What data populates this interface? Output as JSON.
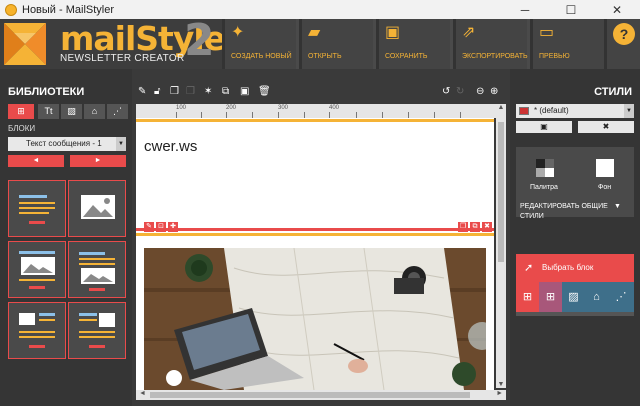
{
  "window": {
    "title": "Новый - MailStyler",
    "minimize": "─",
    "maximize": "☐",
    "close": "✕"
  },
  "logo": {
    "brand": "mailStyler",
    "version": "2",
    "subtitle": "NEWSLETTER CREATOR"
  },
  "toolbar": [
    {
      "label": "СОЗДАТЬ НОВЫЙ",
      "icon": "new-doc-icon",
      "glyph": "✦"
    },
    {
      "label": "ОТКРЫТЬ",
      "icon": "folder-icon",
      "glyph": "▰"
    },
    {
      "label": "СОХРАНИТЬ",
      "icon": "save-icon",
      "glyph": "▣"
    },
    {
      "label": "ЭКСПОРТИРОВАТЬ",
      "icon": "export-icon",
      "glyph": "⇗"
    },
    {
      "label": "ПРЕВЬЮ",
      "icon": "preview-icon",
      "glyph": "▭"
    }
  ],
  "help": "?",
  "left": {
    "title": "БИБЛИОТЕКИ",
    "tabs": [
      "⊞",
      "Tt",
      "▨",
      "⌂",
      "⋰"
    ],
    "blocks_label": "БЛОКИ",
    "select_value": "Текст сообщения - 1",
    "select_arrow": "▼",
    "prev": "◄",
    "next": "►"
  },
  "ruler": {
    "ticks": [
      "100",
      "200",
      "300",
      "400"
    ]
  },
  "canvas": {
    "text": "cwer.ws"
  },
  "right": {
    "title": "СТИЛИ",
    "select_value": "* (default)",
    "select_arrow": "▼",
    "save_btn": "▣",
    "delete_btn": "✖",
    "palette_label": "Палитра",
    "background_label": "Фон",
    "edit_styles": "РЕДАКТИРОВАТЬ ОБЩИЕ СТИЛИ",
    "edit_arrow": "▼",
    "select_block": "Выбрать блок"
  },
  "colors": {
    "accent_orange": "#f5b336",
    "accent_red": "#e94b4b",
    "panel": "#353535"
  }
}
